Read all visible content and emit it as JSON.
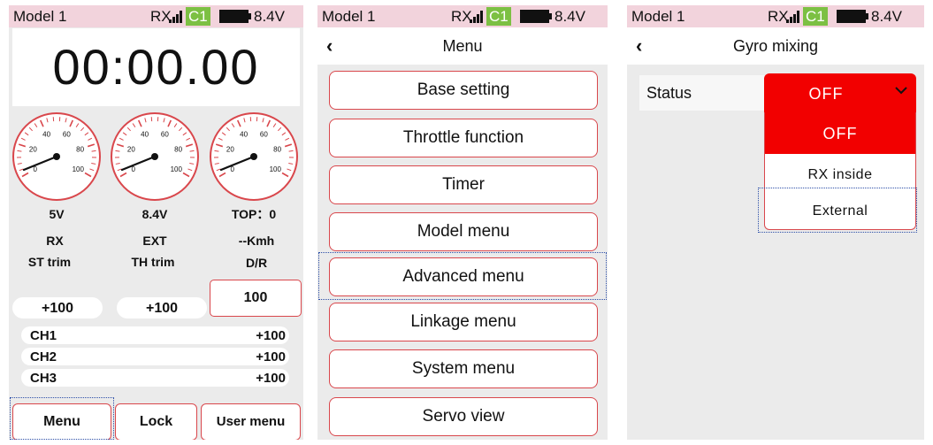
{
  "status_bar": {
    "model": "Model 1",
    "rx": "RX",
    "channel": "C1",
    "voltage": "8.4V",
    "channel_color": "#7cc043",
    "background": "#f2d3dc"
  },
  "main_screen": {
    "timer": "00:00.00",
    "gauge_ticks": [
      "0",
      "20",
      "40",
      "60",
      "80",
      "100"
    ],
    "gauges": [
      {
        "value": "5V",
        "label": "RX"
      },
      {
        "value": "8.4V",
        "label": "EXT"
      },
      {
        "value": "TOP：0",
        "label": "--Kmh"
      }
    ],
    "trims": [
      {
        "label": "ST trim",
        "value": "+100"
      },
      {
        "label": "TH trim",
        "value": "+100"
      },
      {
        "label": "D/R",
        "value": "100"
      }
    ],
    "channels": [
      {
        "name": "CH1",
        "value": "+100"
      },
      {
        "name": "CH2",
        "value": "+100"
      },
      {
        "name": "CH3",
        "value": "+100"
      }
    ],
    "buttons": {
      "menu": "Menu",
      "lock": "Lock",
      "user_menu": "User menu"
    }
  },
  "menu_screen": {
    "title": "Menu",
    "back_icon": "chevron-left-icon",
    "items": [
      "Base setting",
      "Throttle function",
      "Timer",
      "Model menu",
      "Advanced menu",
      "Linkage menu",
      "System menu",
      "Servo view"
    ]
  },
  "gyro_screen": {
    "title": "Gyro mixing",
    "status_label": "Status",
    "selected": "OFF",
    "selected_color": "#f20000",
    "options": [
      "OFF",
      "RX inside",
      "External"
    ]
  }
}
